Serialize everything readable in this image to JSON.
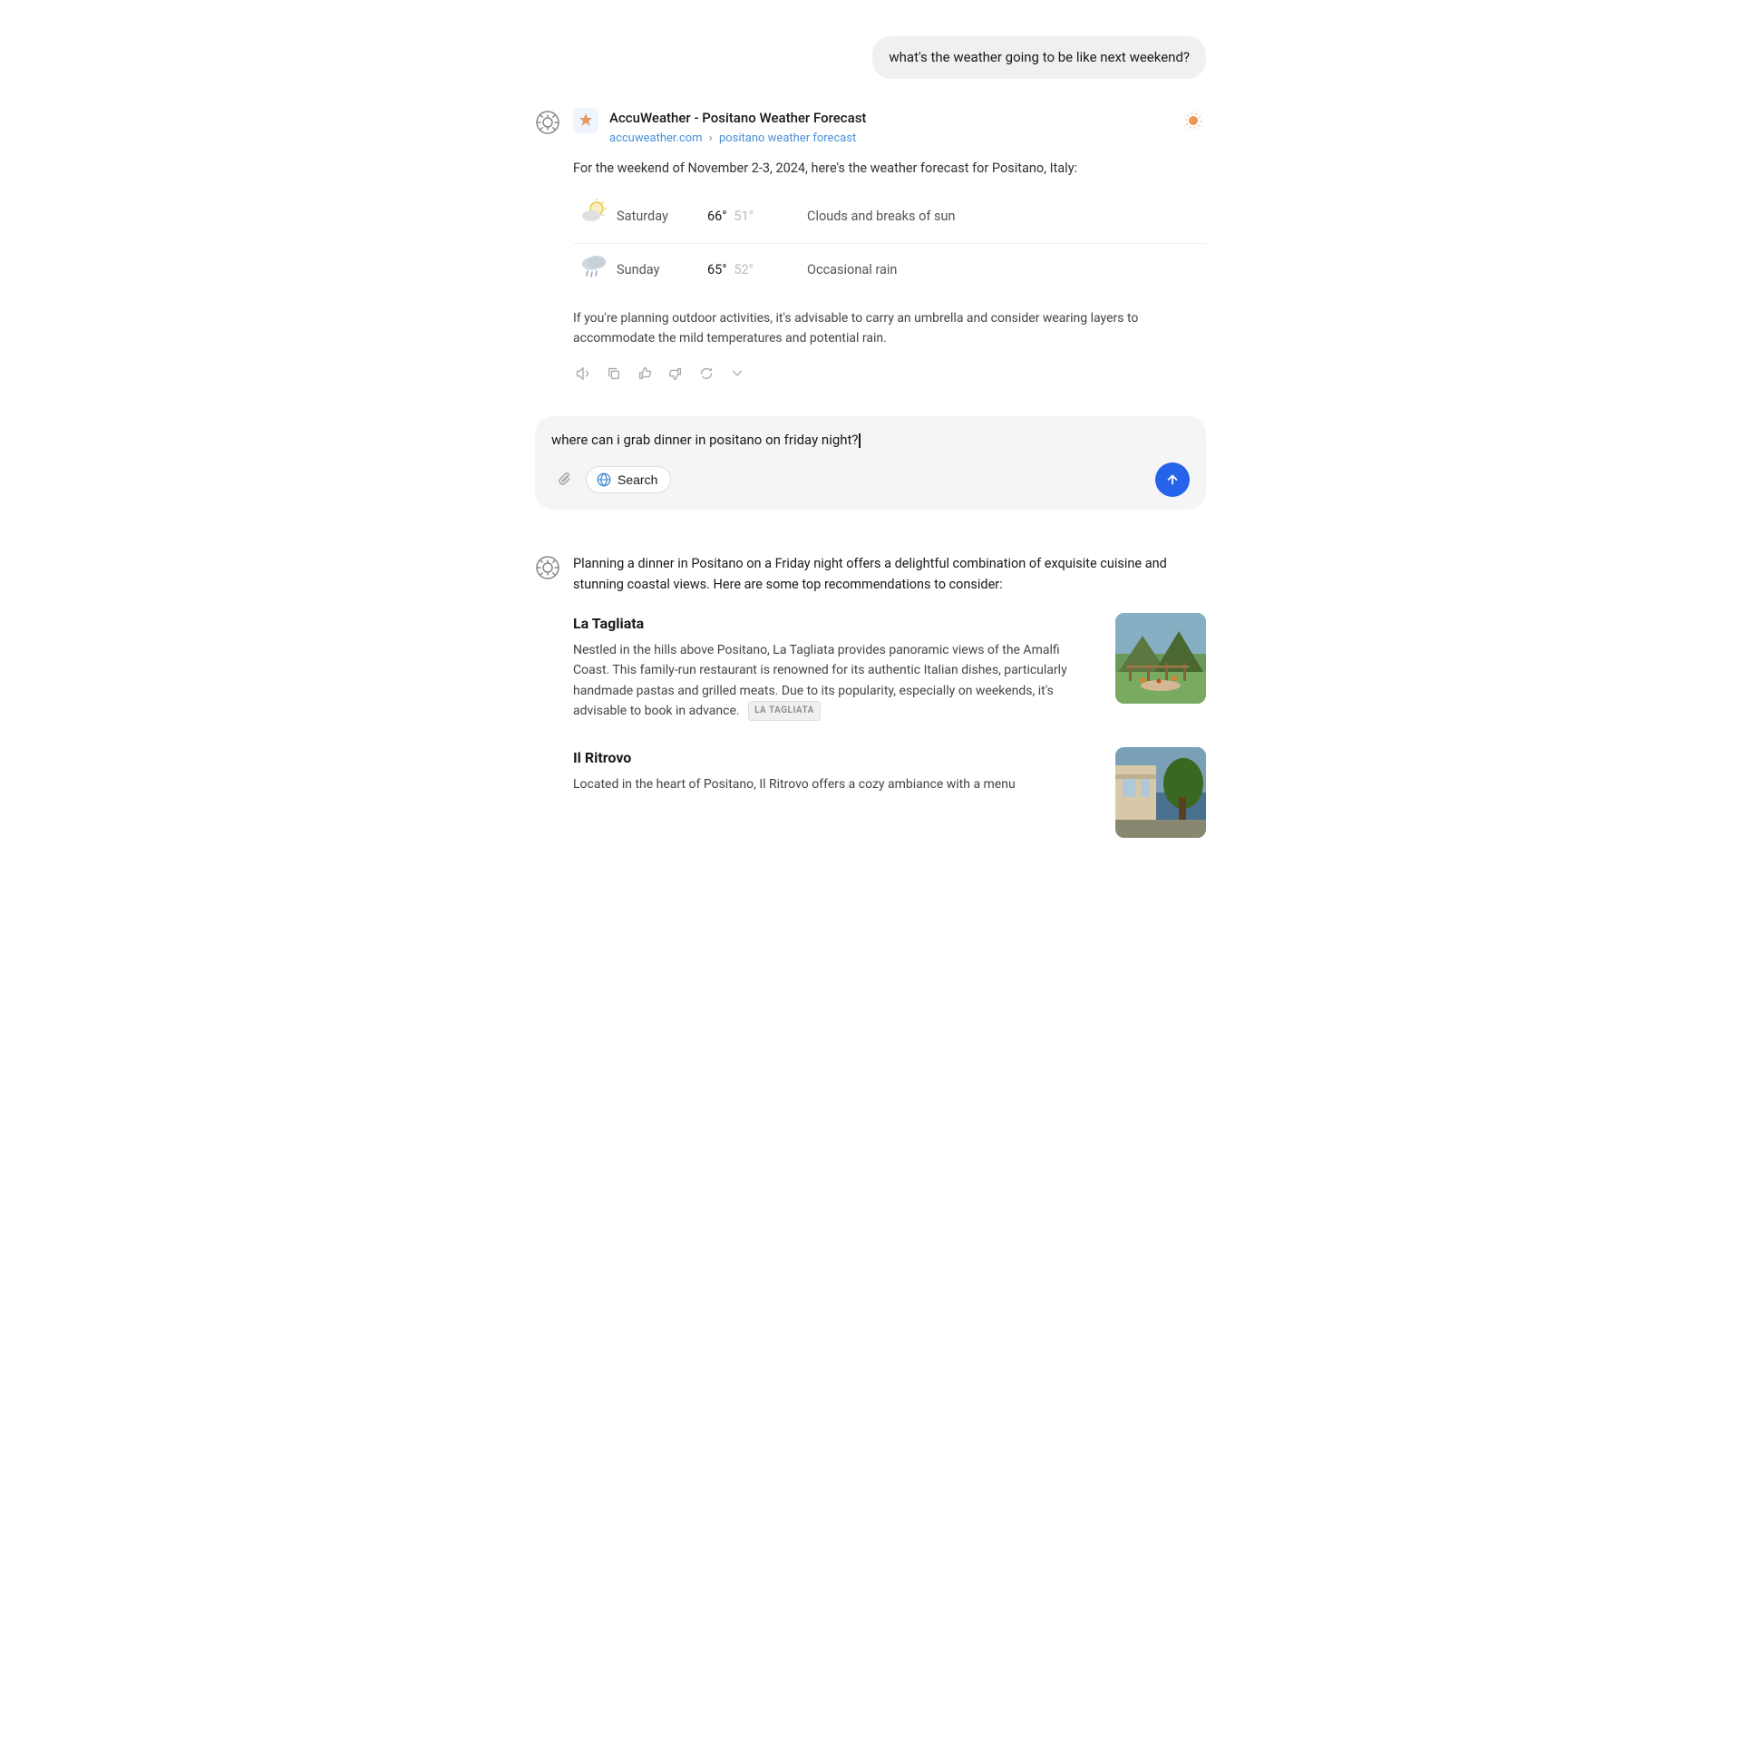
{
  "chat": {
    "user_message_1": "what's the weather going to be like next weekend?",
    "source": {
      "title": "AccuWeather - Positano Weather Forecast",
      "domain": "accuweather.com",
      "breadcrumb": "positano weather forecast",
      "intro": "For the weekend of November 2-3, 2024, here's the weather forecast for Positano, Italy:"
    },
    "forecast": [
      {
        "day": "Saturday",
        "high": "66°",
        "low": "51°",
        "desc": "Clouds and breaks of sun",
        "icon": "⛅"
      },
      {
        "day": "Sunday",
        "high": "65°",
        "low": "52°",
        "desc": "Occasional rain",
        "icon": "🌧"
      }
    ],
    "forecast_note": "If you're planning outdoor activities, it's advisable to carry an umbrella and consider wearing layers to accommodate the mild temperatures and potential rain.",
    "user_message_2": "where can i grab dinner in positano on friday night?",
    "response_intro": "Planning a dinner in Positano on a Friday night offers a delightful combination of exquisite cuisine and stunning coastal views. Here are some top recommendations to consider:",
    "restaurants": [
      {
        "name": "La Tagliata",
        "desc": "Nestled in the hills above Positano, La Tagliata provides panoramic views of the Amalfi Coast. This family-run restaurant is renowned for its authentic Italian dishes, particularly handmade pastas and grilled meats. Due to its popularity, especially on weekends, it's advisable to book in advance.",
        "tag": "LA TAGLIATA"
      },
      {
        "name": "Il Ritrovo",
        "desc": "Located in the heart of Positano, Il Ritrovo offers a cozy ambiance with a menu"
      }
    ],
    "toolbar": {
      "search_label": "Search",
      "attach_label": "Attach",
      "send_label": "Send"
    }
  }
}
